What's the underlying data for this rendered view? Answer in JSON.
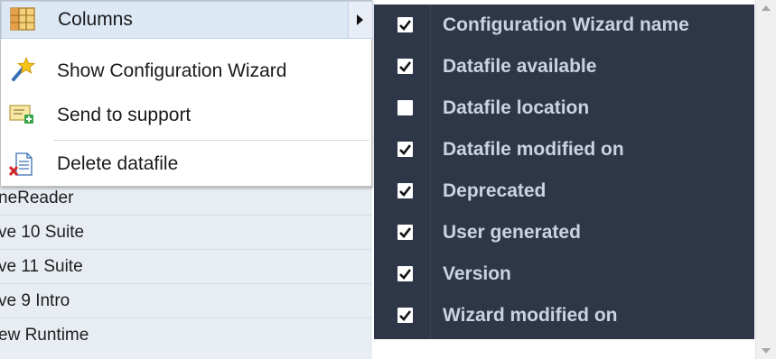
{
  "context_menu": {
    "items": [
      {
        "label": "Columns",
        "icon": "columns-grid-icon",
        "has_submenu": true
      },
      {
        "label": "Show Configuration Wizard",
        "icon": "wizard-wand-icon"
      },
      {
        "label": "Send to support",
        "icon": "send-support-icon"
      },
      {
        "label": "Delete datafile",
        "icon": "delete-file-icon"
      }
    ]
  },
  "columns_submenu": {
    "items": [
      {
        "label": "Configuration Wizard name",
        "checked": true
      },
      {
        "label": "Datafile available",
        "checked": true
      },
      {
        "label": "Datafile location",
        "checked": false
      },
      {
        "label": "Datafile modified on",
        "checked": true
      },
      {
        "label": "Deprecated",
        "checked": true
      },
      {
        "label": "User generated",
        "checked": true
      },
      {
        "label": "Version",
        "checked": true
      },
      {
        "label": "Wizard modified on",
        "checked": true
      }
    ]
  },
  "background_list": {
    "rows": [
      "neReader",
      "ve 10 Suite",
      "ve 11 Suite",
      "ve 9 Intro",
      "ew Runtime"
    ]
  },
  "colors": {
    "submenu_bg": "#2e3747",
    "submenu_text": "#c9d3e3",
    "menu_highlight": "#dde8f5"
  }
}
